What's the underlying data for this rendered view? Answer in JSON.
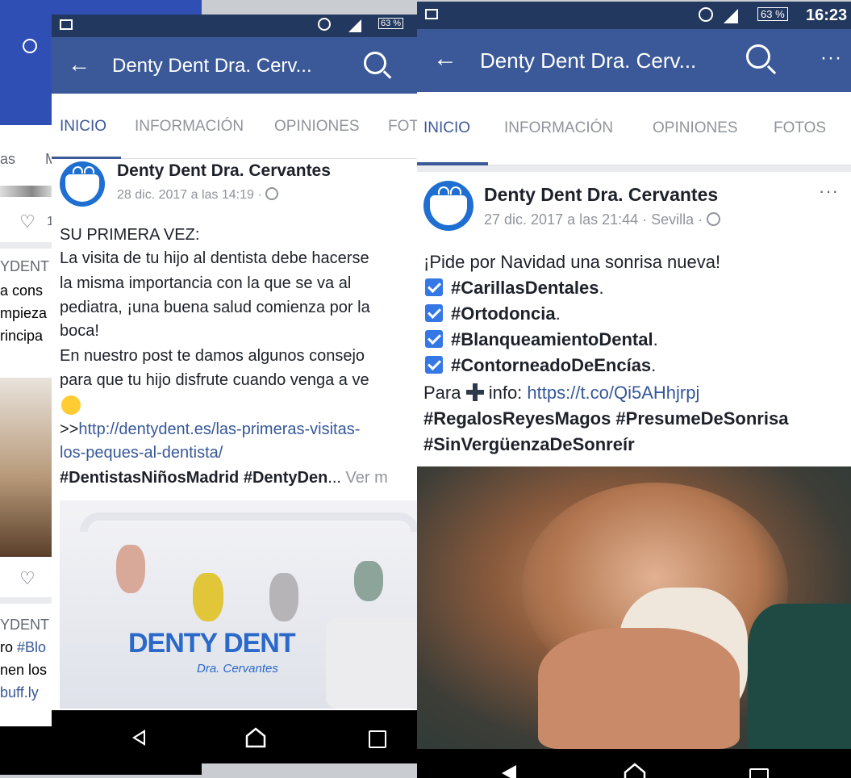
{
  "phone_back": {
    "tab_partial": "as",
    "tab_partial2": "M",
    "like_count_partial": "1",
    "author_partial_1": "YDENT",
    "text_partial_1": [
      "a cons",
      "mpieza",
      "rincipa"
    ],
    "author_partial_2": "YDENT",
    "text_partial_2": [
      "ro",
      "#Blo",
      "nen los",
      "buff.ly"
    ]
  },
  "phone_middle": {
    "status": {
      "battery": "63 %"
    },
    "appbar": {
      "title": "Denty Dent Dra. Cerv..."
    },
    "tabs": [
      "INICIO",
      "INFORMACIÓN",
      "OPINIONES",
      "FOT"
    ],
    "post": {
      "author": "Denty Dent Dra. Cervantes",
      "meta": "28 dic. 2017 a las 14:19 · ",
      "lines": [
        "SU PRIMERA VEZ:",
        "La visita de tu hijo al dentista debe hacerse",
        "la misma importancia con la que se va al",
        "pediatra, ¡una buena salud comienza por la",
        "boca!",
        "En nuestro post te damos algunos consejo",
        "para que tu hijo disfrute cuando venga a ve"
      ],
      "link_prefix": ">>",
      "link_line1": "http://dentydent.es/las-primeras-visitas-",
      "link_line2": "los-peques-al-dentista/",
      "hashtags": "#DentistasNiñosMadrid #DentyDen",
      "ellipsis": "...",
      "more": " Ver m",
      "image_logo": "DENTY DENT",
      "image_sub": "Dra. Cervantes"
    }
  },
  "phone_front": {
    "status": {
      "battery": "63 %",
      "time": "16:23"
    },
    "appbar": {
      "title": "Denty Dent Dra. Cerv..."
    },
    "tabs": [
      "INICIO",
      "INFORMACIÓN",
      "OPINIONES",
      "FOTOS"
    ],
    "post": {
      "author": "Denty Dent Dra. Cervantes",
      "meta": "27 dic. 2017 a las 21:44 · Sevilla · ",
      "intro": "¡Pide por Navidad una sonrisa nueva!",
      "checks": [
        "#CarillasDentales",
        "#Ortodoncia",
        "#BlanqueamientoDental",
        "#ContorneadoDeEncías"
      ],
      "info_prefix": "Para ",
      "info_mid": " info: ",
      "info_link": "https://t.co/Qi5AHhjrpj",
      "hashtags_line1": "#RegalosReyesMagos #PresumeDeSonrisa",
      "hashtags_line2": "#SinVergüenzaDeSonreír"
    }
  },
  "colors": {
    "fb_blue": "#3b5998",
    "status_dark": "#23385e",
    "check_blue": "#3578e5",
    "link": "#365899"
  }
}
